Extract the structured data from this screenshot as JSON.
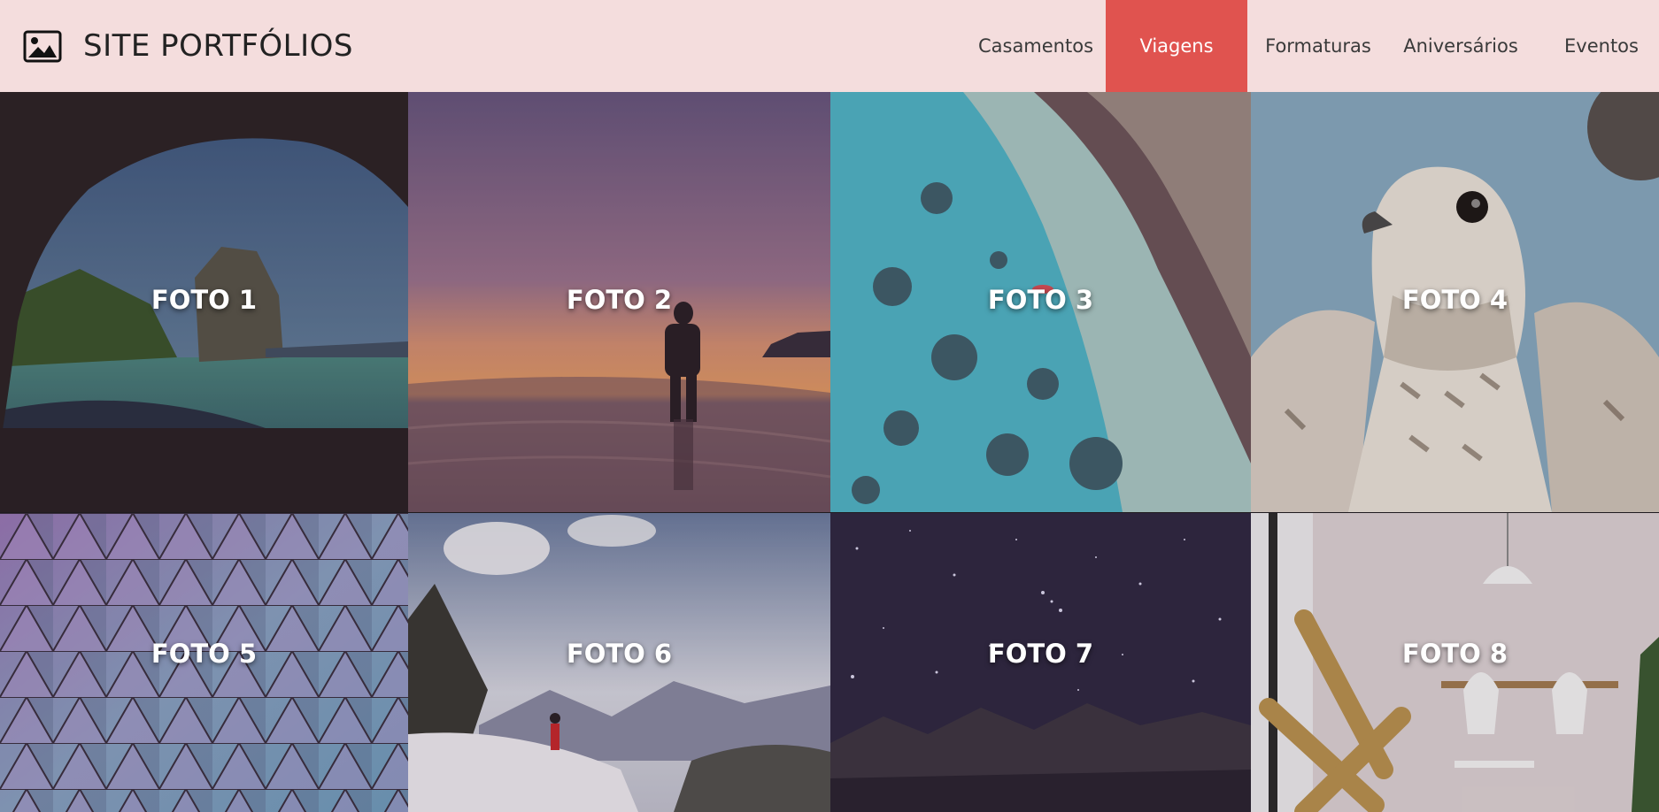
{
  "header": {
    "title": "SITE PORTFÓLIOS",
    "logo_icon": "image-icon",
    "background": "#f4dddd"
  },
  "nav": {
    "items": [
      {
        "label": "Casamentos",
        "active": false
      },
      {
        "label": "Viagens",
        "active": true
      },
      {
        "label": "Formaturas",
        "active": false
      },
      {
        "label": "Aniversários",
        "active": false
      },
      {
        "label": "Eventos",
        "active": false
      }
    ],
    "active_color": "#e0534f"
  },
  "gallery": {
    "photos": [
      {
        "label": "FOTO 1",
        "subject": "sea cave beach"
      },
      {
        "label": "FOTO 2",
        "subject": "sunset beach silhouette"
      },
      {
        "label": "FOTO 3",
        "subject": "aerial reef"
      },
      {
        "label": "FOTO 4",
        "subject": "falcon"
      },
      {
        "label": "FOTO 5",
        "subject": "geodesic dome"
      },
      {
        "label": "FOTO 6",
        "subject": "snowy mountain"
      },
      {
        "label": "FOTO 7",
        "subject": "starry night sky"
      },
      {
        "label": "FOTO 8",
        "subject": "interior chairs"
      }
    ]
  }
}
